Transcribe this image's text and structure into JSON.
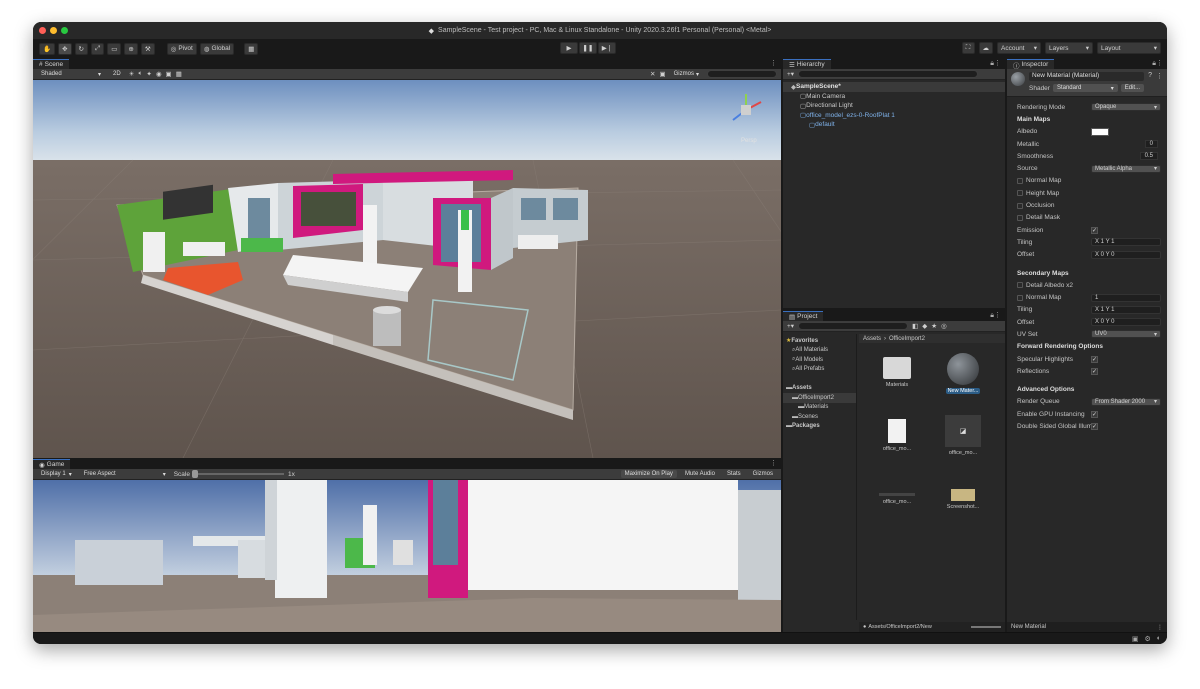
{
  "window": {
    "title": "SampleScene - Test project - PC, Mac & Linux Standalone - Unity 2020.3.26f1 Personal (Personal) <Metal>",
    "traffic_colors": [
      "#ff5f57",
      "#febc2e",
      "#28c840"
    ]
  },
  "toolbar": {
    "pivot_label": "Pivot",
    "global_label": "Global",
    "account_label": "Account",
    "layers_label": "Layers",
    "layout_label": "Layout"
  },
  "scene": {
    "tab_label": "Scene",
    "shading_mode": "Shaded",
    "two_d_label": "2D",
    "gizmos_label": "Gizmos",
    "gizmo_persp_label": "Persp"
  },
  "game": {
    "tab_label": "Game",
    "display_label": "Display 1",
    "aspect_label": "Free Aspect",
    "scale_label": "Scale",
    "scale_value": "1x",
    "maximize_label": "Maximize On Play",
    "mute_label": "Mute Audio",
    "stats_label": "Stats",
    "gizmos_label": "Gizmos"
  },
  "hierarchy": {
    "tab_label": "Hierarchy",
    "items": [
      {
        "label": "SampleScene*",
        "indent": 0,
        "kind": "header"
      },
      {
        "label": "Main Camera",
        "indent": 1,
        "kind": "object"
      },
      {
        "label": "Directional Light",
        "indent": 1,
        "kind": "object"
      },
      {
        "label": "office_model_ezs-0-RoofPlat 1",
        "indent": 1,
        "kind": "prefab"
      },
      {
        "label": "default",
        "indent": 2,
        "kind": "prefab"
      }
    ]
  },
  "project": {
    "tab_label": "Project",
    "breadcrumb_root": "Assets",
    "breadcrumb_folder": "OfficeImport2",
    "tree": [
      {
        "label": "Favorites",
        "indent": 0,
        "bold": true
      },
      {
        "label": "All Materials",
        "indent": 1,
        "bold": false
      },
      {
        "label": "All Models",
        "indent": 1,
        "bold": false
      },
      {
        "label": "All Prefabs",
        "indent": 1,
        "bold": false
      },
      {
        "label": "",
        "indent": 0,
        "bold": false
      },
      {
        "label": "Assets",
        "indent": 0,
        "bold": true
      },
      {
        "label": "OfficeImport2",
        "indent": 1,
        "bold": false
      },
      {
        "label": "Materials",
        "indent": 2,
        "bold": false
      },
      {
        "label": "Scenes",
        "indent": 1,
        "bold": false
      },
      {
        "label": "Packages",
        "indent": 0,
        "bold": true
      }
    ],
    "assets": [
      {
        "label": "Materials",
        "icon": "folder-icon",
        "selected": false
      },
      {
        "label": "New Mater...",
        "icon": "material-sphere-icon",
        "selected": true
      },
      {
        "label": "office_mo...",
        "icon": "file-icon",
        "selected": false
      },
      {
        "label": "office_mo...",
        "icon": "model-prefab-icon",
        "selected": false
      },
      {
        "label": "office_mo...",
        "icon": "texture-icon",
        "selected": false
      },
      {
        "label": "Screenshot...",
        "icon": "image-icon",
        "selected": false
      }
    ],
    "path_label": "Assets/OfficeImport2/New"
  },
  "inspector": {
    "tab_label": "Inspector",
    "material_name": "New Material (Material)",
    "shader_label": "Shader",
    "shader_value": "Standard",
    "edit_label": "Edit...",
    "rows": [
      {
        "label": "Rendering Mode",
        "value": "Opaque",
        "type": "dropdown",
        "kind": "field"
      },
      {
        "label": "Main Maps",
        "value": "",
        "type": "none",
        "kind": "section"
      },
      {
        "label": "Albedo",
        "value": "",
        "type": "color",
        "kind": "field"
      },
      {
        "label": "Metallic",
        "value": "0",
        "type": "slider",
        "kind": "field"
      },
      {
        "label": "Smoothness",
        "value": "0.5",
        "type": "slider",
        "kind": "field"
      },
      {
        "label": "Source",
        "value": "Metallic Alpha",
        "type": "dropdown",
        "kind": "field"
      },
      {
        "label": "Normal Map",
        "value": "",
        "type": "none",
        "kind": "check"
      },
      {
        "label": "Height Map",
        "value": "",
        "type": "none",
        "kind": "check"
      },
      {
        "label": "Occlusion",
        "value": "",
        "type": "none",
        "kind": "check"
      },
      {
        "label": "Detail Mask",
        "value": "",
        "type": "none",
        "kind": "check"
      },
      {
        "label": "Emission",
        "value": "",
        "type": "checkbox",
        "kind": "field"
      },
      {
        "label": "Tiling",
        "value": "X 1      Y 1",
        "type": "xy",
        "kind": "field"
      },
      {
        "label": "Offset",
        "value": "X 0      Y 0",
        "type": "xy",
        "kind": "field"
      },
      {
        "label": "",
        "value": "",
        "type": "none",
        "kind": "spacer"
      },
      {
        "label": "Secondary Maps",
        "value": "",
        "type": "none",
        "kind": "section"
      },
      {
        "label": "Detail Albedo x2",
        "value": "",
        "type": "none",
        "kind": "check"
      },
      {
        "label": "Normal Map",
        "value": "1",
        "type": "number",
        "kind": "check"
      },
      {
        "label": "Tiling",
        "value": "X 1      Y 1",
        "type": "xy",
        "kind": "field"
      },
      {
        "label": "Offset",
        "value": "X 0      Y 0",
        "type": "xy",
        "kind": "field"
      },
      {
        "label": "UV Set",
        "value": "UV0",
        "type": "dropdown",
        "kind": "field"
      },
      {
        "label": "Forward Rendering Options",
        "value": "",
        "type": "none",
        "kind": "section"
      },
      {
        "label": "Specular Highlights",
        "value": "",
        "type": "checkbox",
        "kind": "field"
      },
      {
        "label": "Reflections",
        "value": "",
        "type": "checkbox",
        "kind": "field"
      },
      {
        "label": "",
        "value": "",
        "type": "none",
        "kind": "spacer"
      },
      {
        "label": "Advanced Options",
        "value": "",
        "type": "none",
        "kind": "section"
      },
      {
        "label": "Render Queue",
        "value": "From Shader    2000",
        "type": "dropdown",
        "kind": "field"
      },
      {
        "label": "Enable GPU Instancing",
        "value": "",
        "type": "checkbox",
        "kind": "field"
      },
      {
        "label": "Double Sided Global Illum.",
        "value": "",
        "type": "checkbox",
        "kind": "field"
      }
    ],
    "footer_label": "New Material"
  },
  "colors": {
    "accent_blue": "#3a6fbf",
    "wall_magenta": "#d0197e",
    "wall_green": "#5ea33a",
    "sofa_orange": "#e8552e"
  }
}
